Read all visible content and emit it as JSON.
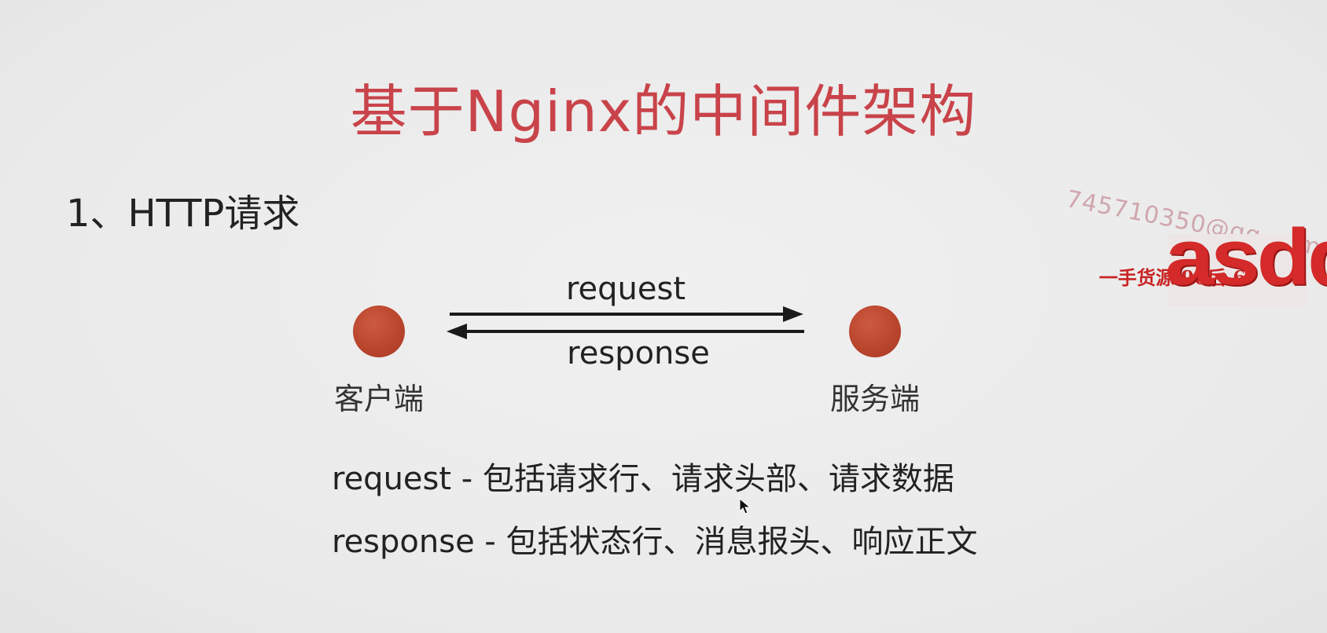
{
  "title": "基于Nginx的中间件架构",
  "section_heading": "1、HTTP请求",
  "diagram": {
    "client_label": "客户端",
    "server_label": "服务端",
    "request_arrow_label": "request",
    "response_arrow_label": "response"
  },
  "descriptions": {
    "request": "request - 包括请求行、请求头部、请求数据",
    "response": "response - 包括状态行、消息报头、响应正文"
  },
  "watermark": {
    "email": "745710350@qq.com",
    "chinese_text": "一手货源 90后 6",
    "logo_text": "asdd"
  },
  "colors": {
    "title": "#c9434a",
    "node_fill": "#b8442c",
    "watermark_red": "#d42a2a"
  },
  "icons": {
    "cursor": "mouse-cursor-icon",
    "arrow_right": "arrow-right-icon",
    "arrow_left": "arrow-left-icon"
  }
}
